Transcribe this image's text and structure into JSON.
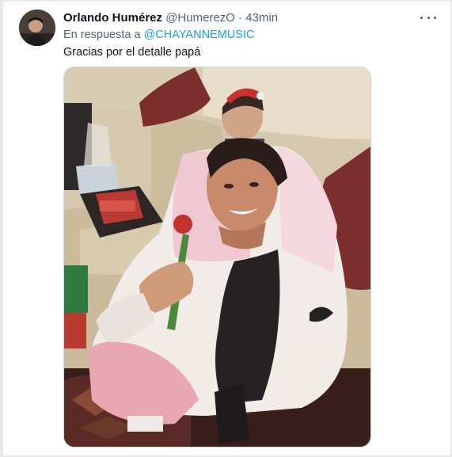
{
  "tweet": {
    "author_name": "Orlando Humérez",
    "handle": "@HumerezO",
    "separator": "·",
    "time": "43min",
    "reply_prefix": "En respuesta a",
    "reply_to": "@CHAYANNEMUSIC",
    "text": "Gracias por el detalle papá"
  },
  "icons": {
    "more": "more-horizontal-icon"
  },
  "colors": {
    "link": "#1d9bf0",
    "secondary_text": "#536471",
    "primary_text": "#0f1419"
  }
}
